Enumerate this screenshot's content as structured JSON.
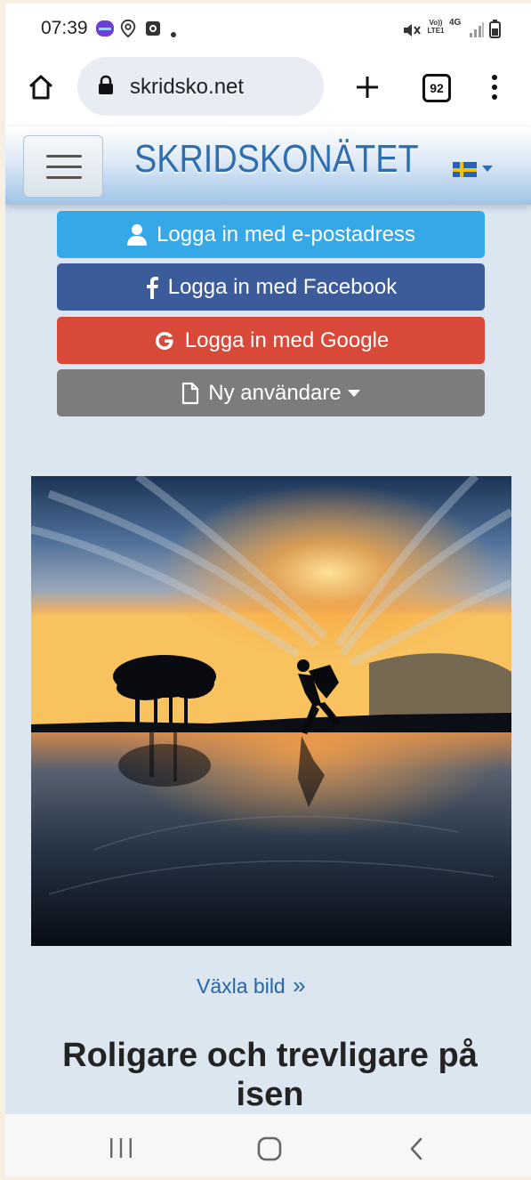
{
  "status_bar": {
    "time": "07:39",
    "network_label_top": "Vo))",
    "network_label_bottom": "LTE1",
    "network_type": "4G",
    "icons": [
      "app-badge-icon",
      "location-icon",
      "media-icon",
      "dot-icon",
      "mute-icon",
      "signal-icon",
      "battery-icon"
    ]
  },
  "browser": {
    "url": "skridsko.net",
    "tab_count": "92",
    "icons": [
      "home-icon",
      "lock-icon",
      "new-tab-icon",
      "tabs-icon",
      "more-icon"
    ]
  },
  "site": {
    "logo_text": "SKRIDSKONÄTET",
    "language_flag": "sweden-flag-icon"
  },
  "buttons": {
    "email": "Logga in med e-postadress",
    "facebook": "Logga in med Facebook",
    "google": "Logga in med Google",
    "new_user": "Ny användare"
  },
  "links": {
    "toggle_image": "Växla bild"
  },
  "headline": {
    "line1": "Roligare och trevligare på",
    "line2": "isen"
  },
  "colors": {
    "email_button": "#36a8e8",
    "facebook_button": "#3b5b9b",
    "google_button": "#d8493a",
    "new_user_button": "#7c7c7c",
    "page_background": "#dbe6f1",
    "link": "#2765a6"
  },
  "nav_bar": {
    "icons": [
      "recent-apps-icon",
      "home-nav-icon",
      "back-icon"
    ]
  }
}
